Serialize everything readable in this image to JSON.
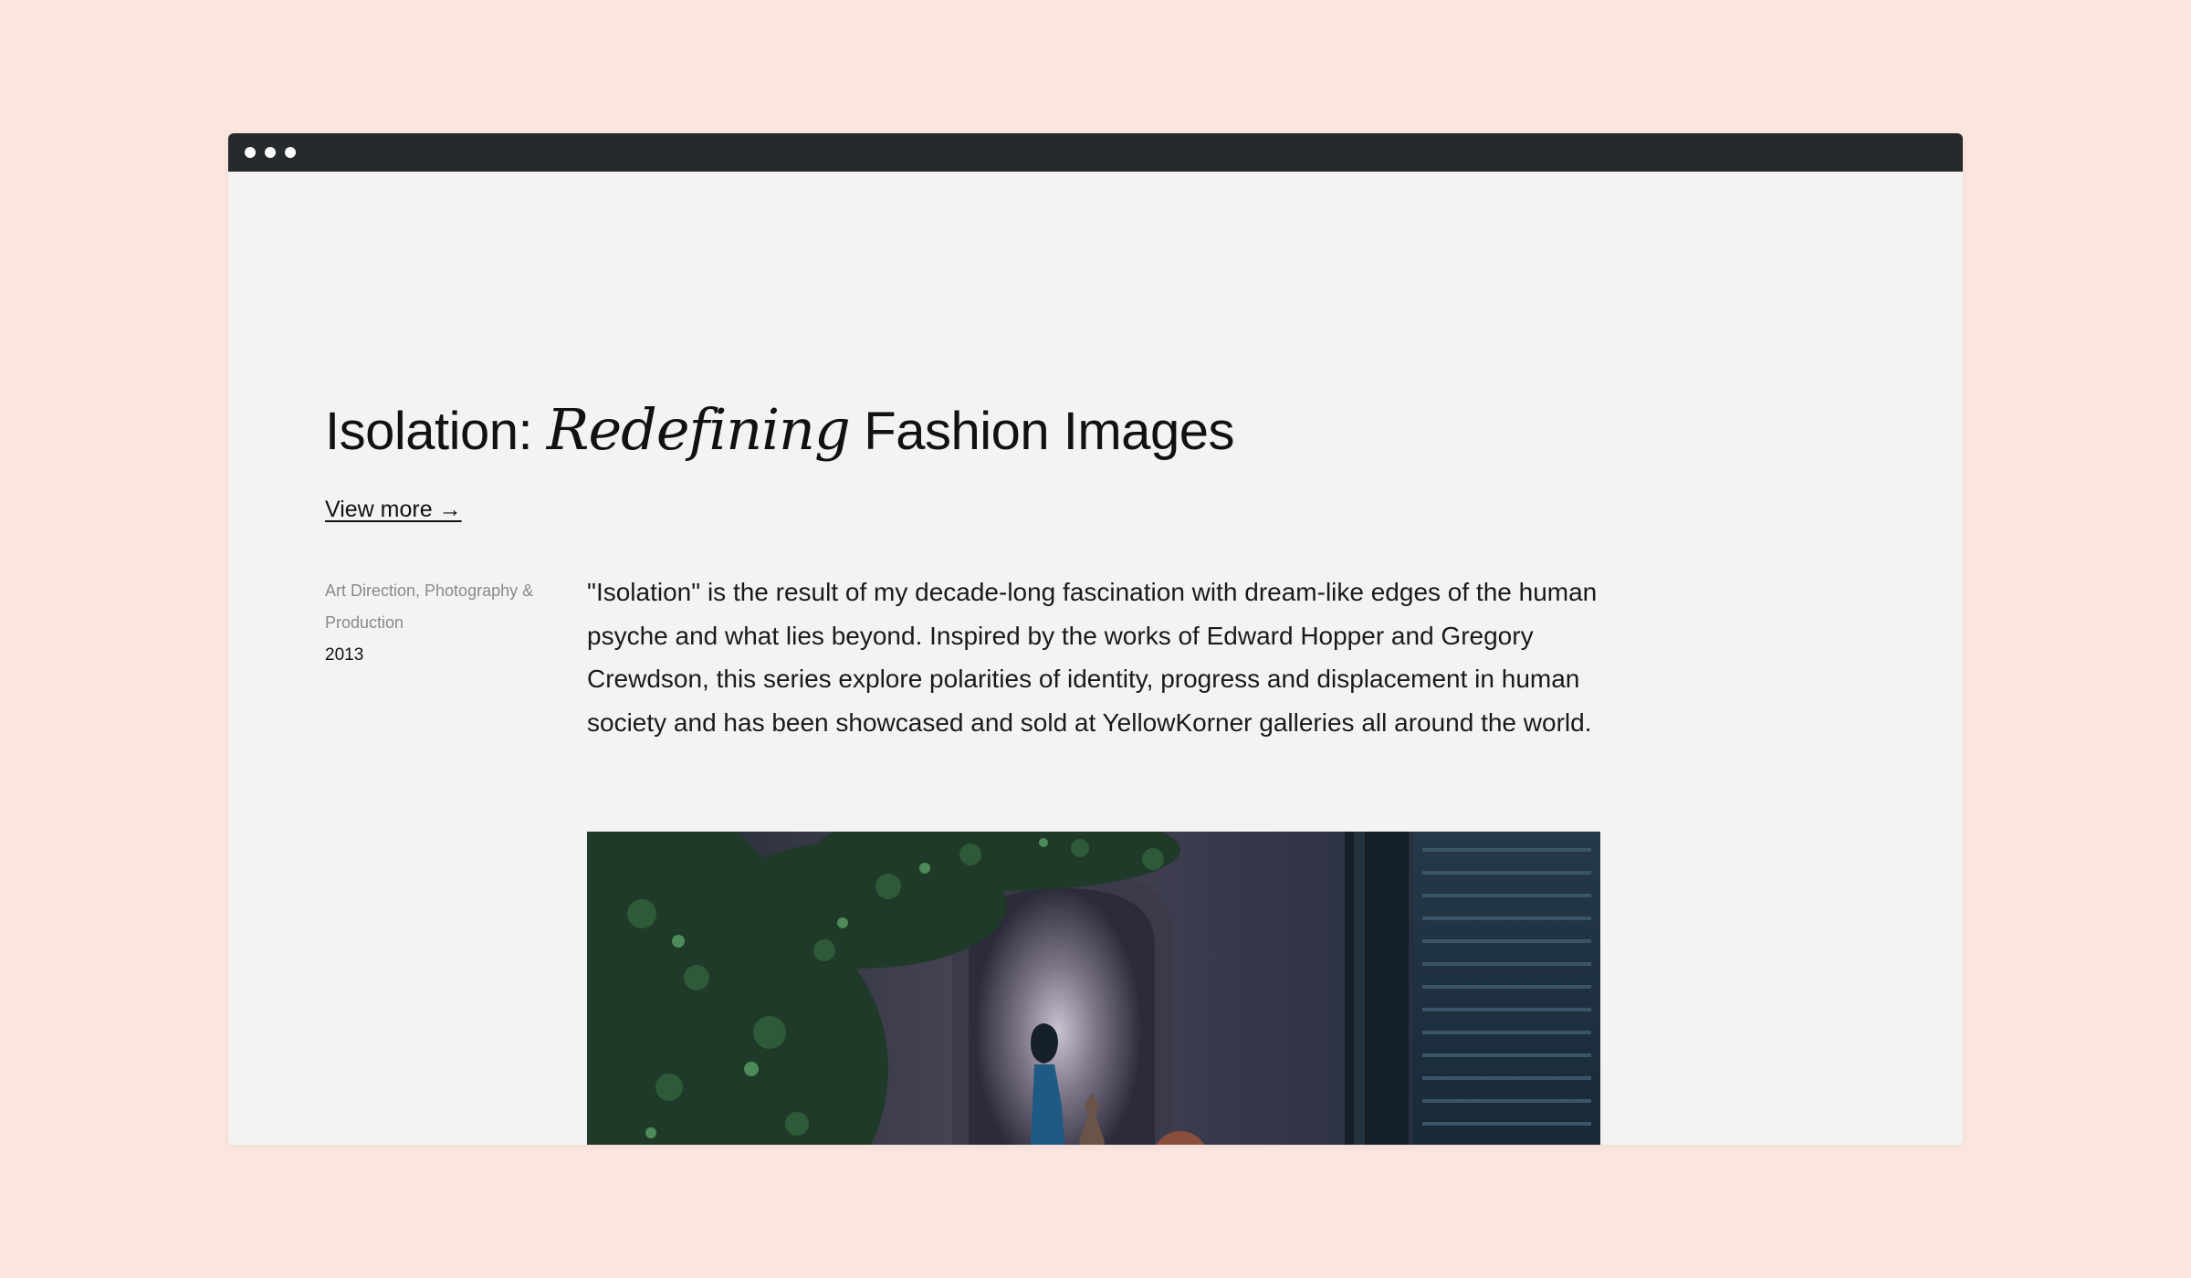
{
  "window": {
    "titlebar_dots": [
      "dot",
      "dot",
      "dot"
    ]
  },
  "project": {
    "title_part1": "Isolation: ",
    "title_emphasis": "Redefining",
    "title_part2": " Fashion Images",
    "view_more": "View more →",
    "categories": "Art Direction, Photography & Production",
    "year": "2013",
    "description": "\"Isolation\" is the result of my decade-long fascination with dream-like edges of the human psyche and what lies beyond. Inspired by the works of Edward Hopper and Gregory Crewdson, this series explore polarities of identity, progress and displacement in human society and has been showcased and sold at YellowKorner galleries all around the world."
  },
  "colors": {
    "page_background": "#fae6df",
    "window_background": "#f4f2f3",
    "titlebar": "#262a2c",
    "text": "#111111",
    "muted_text": "#8a8a8a"
  },
  "photo": {
    "icon": "project-photo"
  }
}
